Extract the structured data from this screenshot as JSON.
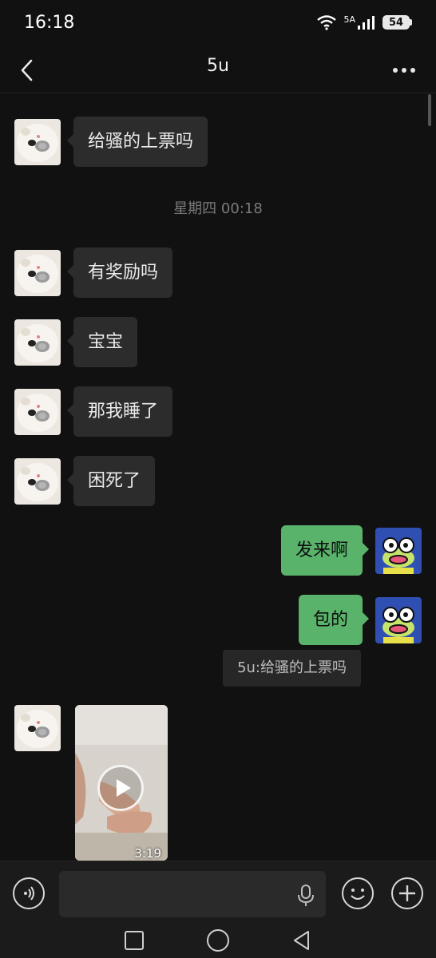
{
  "status_bar": {
    "time": "16:18",
    "network": "5A",
    "battery": "54"
  },
  "header": {
    "title": "5u",
    "back_icon": "chevron-left-icon",
    "more_icon": "more-dots-icon"
  },
  "messages": {
    "m1": "给骚的上票吗",
    "time_separator": "星期四 00:18",
    "m2": "有奖励吗",
    "m3": "宝宝",
    "m4": "那我睡了",
    "m5": "困死了",
    "m6": "发来啊",
    "m7": "包的",
    "quote": "5u:给骚的上票吗",
    "video_duration": "3:19"
  },
  "input_bar": {
    "placeholder": "",
    "voice_icon": "voice-icon",
    "mic_icon": "mic-icon",
    "emoji_icon": "emoji-icon",
    "plus_icon": "plus-icon"
  },
  "colors": {
    "background": "#111111",
    "incoming_bubble": "#2c2c2c",
    "outgoing_bubble": "#59b36a"
  }
}
